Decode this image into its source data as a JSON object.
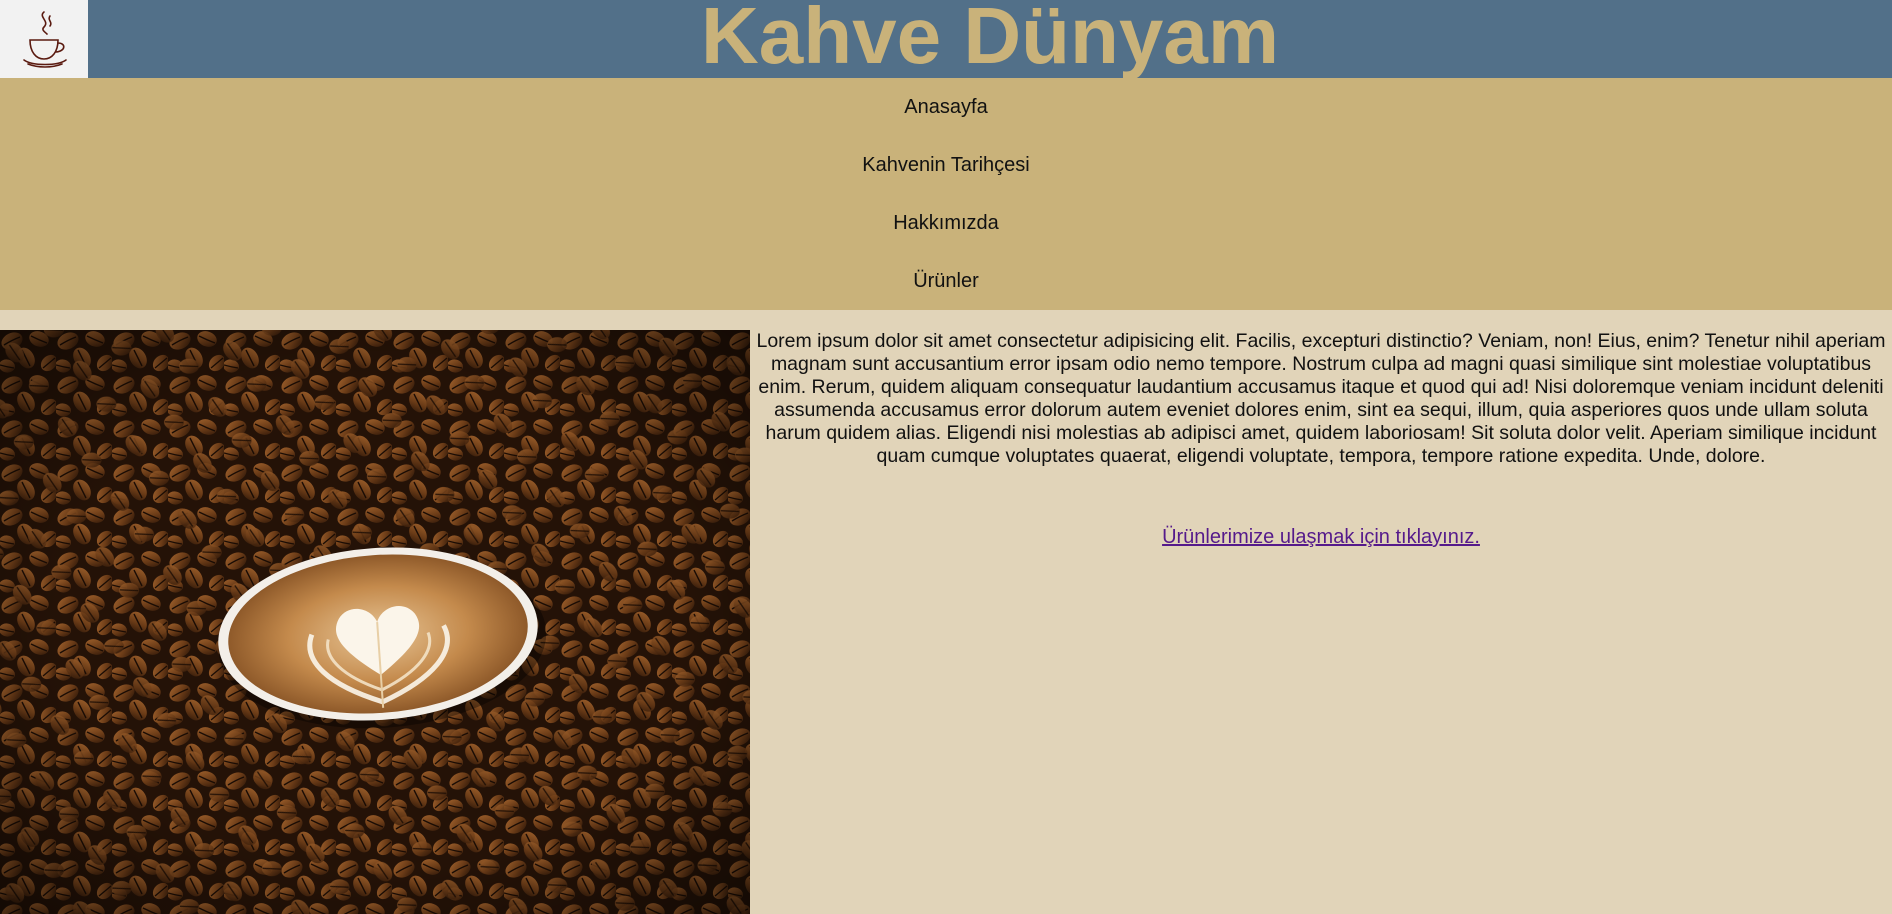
{
  "header": {
    "title": "Kahve Dünyam",
    "logo_icon": "coffee-cup-icon",
    "background_color": "#527089",
    "title_color": "#c9b27a"
  },
  "nav": {
    "background_color": "#c9b27a",
    "items": [
      {
        "label": "Anasayfa"
      },
      {
        "label": "Kahvenin Tarihçesi"
      },
      {
        "label": "Hakkımızda"
      },
      {
        "label": "Ürünler"
      }
    ]
  },
  "main": {
    "hero_image": "coffee-beans-latte-art-image",
    "paragraph": "Lorem ipsum dolor sit amet consectetur adipisicing elit. Facilis, excepturi distinctio? Veniam, non! Eius, enim? Tenetur nihil aperiam magnam sunt accusantium error ipsam odio nemo tempore. Nostrum culpa ad magni quasi similique sint molestiae voluptatibus enim. Rerum, quidem aliquam consequatur laudantium accusamus itaque et quod qui ad! Nisi doloremque veniam incidunt deleniti assumenda accusamus error dolorum autem eveniet dolores enim, sint ea sequi, illum, quia asperiores quos unde ullam soluta harum quidem alias. Eligendi nisi molestias ab adipisci amet, quidem laboriosam! Sit soluta dolor velit. Aperiam similique incidunt quam cumque voluptates quaerat, eligendi voluptate, tempora, tempore ratione expedita. Unde, dolore.",
    "link_label": "Ürünlerimize ulaşmak için tıklayınız.",
    "background_color": "#e1d4b9"
  }
}
